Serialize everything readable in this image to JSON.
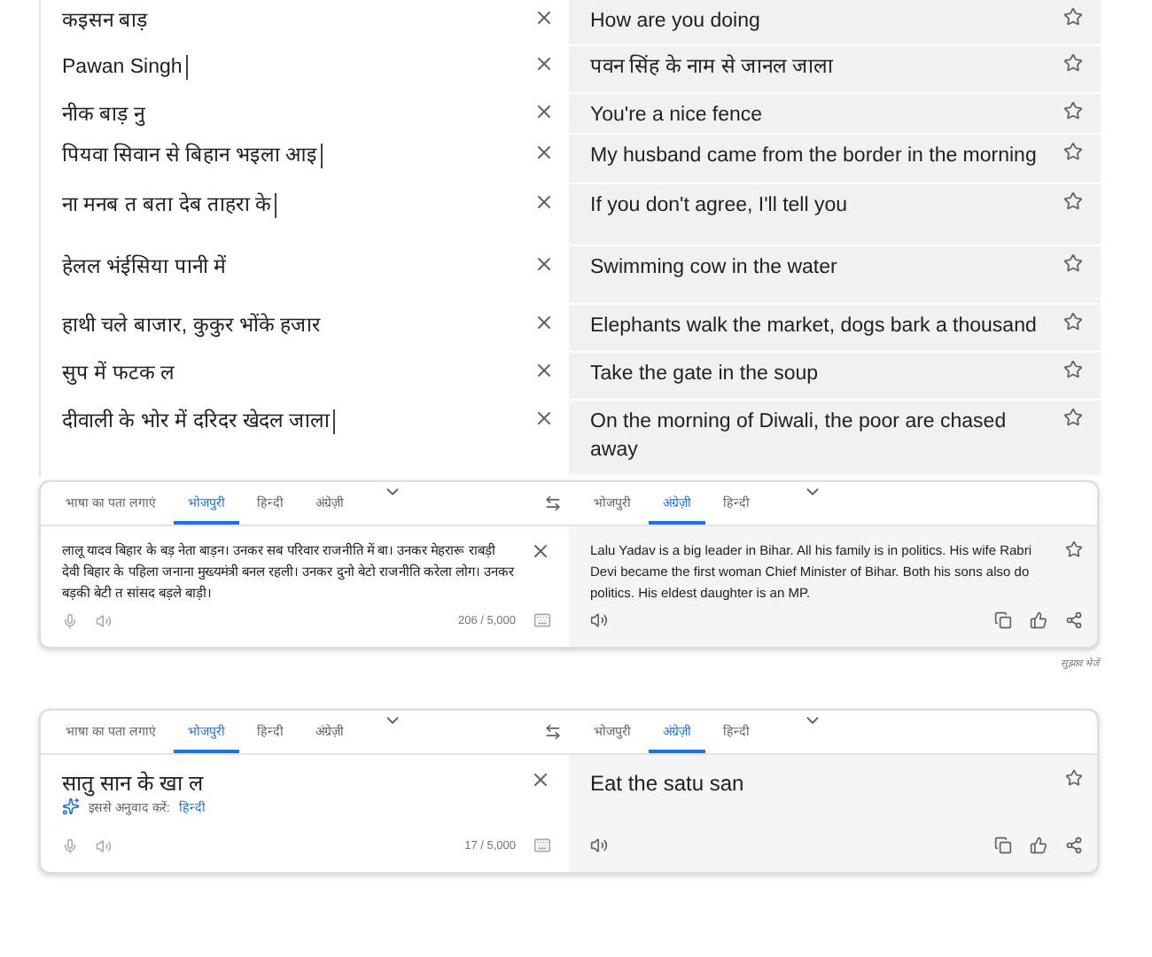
{
  "phrases": [
    {
      "source": "कइसन बाड़",
      "translation": "How are you doing",
      "caret": false
    },
    {
      "source": "Pawan Singh",
      "translation": "पवन सिंह के नाम से जानल जाला",
      "caret": true
    },
    {
      "source": "नीक बाड़ नु",
      "translation": "You're a nice fence",
      "caret": false
    },
    {
      "source": "पियवा सिवान से बिहान भइला आइ",
      "translation": "My husband came from the border in the morning",
      "caret": true
    },
    {
      "source": "ना मनब त बता देब ताहरा के",
      "translation": "If you don't agree, I'll tell you",
      "caret": true
    },
    {
      "source": "हेलल भंईसिया पानी में",
      "translation": "Swimming cow in the water",
      "caret": false
    },
    {
      "source": "हाथी चले बाजार, कुकुर भोंके हजार",
      "translation": "Elephants walk the market, dogs bark a thousand",
      "caret": false
    },
    {
      "source": "सुप में फटक ल",
      "translation": "Take the gate in the soup",
      "caret": false
    },
    {
      "source": "दीवाली के भोर में दरिदर खेदल जाला",
      "translation": "On the morning of Diwali, the poor are chased away",
      "caret": true
    }
  ],
  "panels": [
    {
      "source_tabs": [
        {
          "label": "भाषा का पता लगाएं",
          "selected": false
        },
        {
          "label": "भोजपुरी",
          "selected": true
        },
        {
          "label": "हिन्दी",
          "selected": false
        },
        {
          "label": "अंग्रेज़ी",
          "selected": false
        }
      ],
      "target_tabs": [
        {
          "label": "भोजपुरी",
          "selected": false
        },
        {
          "label": "अंग्रेज़ी",
          "selected": true
        },
        {
          "label": "हिन्दी",
          "selected": false
        }
      ],
      "source_text": "लालू यादव बिहार के बड़ नेता बाड़न। उनकर सब परिवार राजनीति में बा। उनकर मेहरारू राबड़ी देवी बिहार के पहिला जनाना मुख्यमंत्री बनल रहली। उनकर दुनो बेटो राजनीति करेला लोग। उनकर बड़की बेटी त सांसद बड़ले बाड़ी।",
      "counter": "206 / 5,000",
      "target_text": "Lalu Yadav is a big leader in Bihar. All his family is in politics. His wife Rabri Devi became the first woman Chief Minister of Bihar. Both his sons also do politics. His eldest daughter is an MP.",
      "feedback": "सुझाव भेजें"
    },
    {
      "source_tabs": [
        {
          "label": "भाषा का पता लगाएं",
          "selected": false
        },
        {
          "label": "भोजपुरी",
          "selected": true
        },
        {
          "label": "हिन्दी",
          "selected": false
        },
        {
          "label": "अंग्रेज़ी",
          "selected": false
        }
      ],
      "target_tabs": [
        {
          "label": "भोजपुरी",
          "selected": false
        },
        {
          "label": "अंग्रेज़ी",
          "selected": true
        },
        {
          "label": "हिन्दी",
          "selected": false
        }
      ],
      "source_text": "सातु सान के खा ल",
      "large": true,
      "suggestion": {
        "label": "इससे अनुवाद करें:",
        "link": "हिन्दी"
      },
      "counter": "17 / 5,000",
      "target_text": "Eat the satu san"
    }
  ]
}
